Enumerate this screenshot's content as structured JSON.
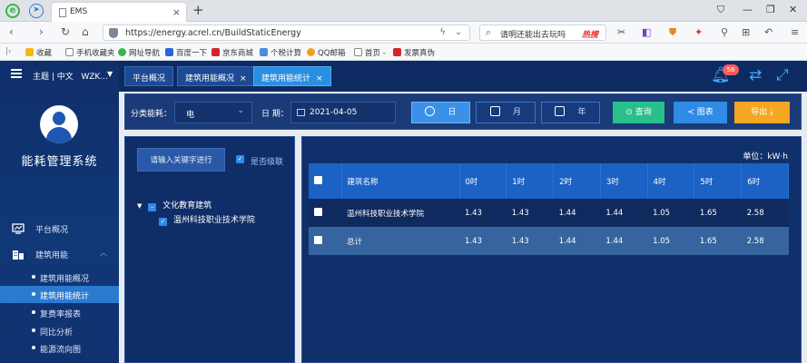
{
  "browser": {
    "tab_title": "EMS",
    "url": "https://energy.acrel.cn/BuildStaticEnergy",
    "search_text": "请明还能出去玩吗",
    "search_hot": "热搜",
    "bookmarks": [
      "收藏",
      "手机收藏夹",
      "网址导航",
      "百度一下",
      "京东商城",
      "个税计算",
      "QQ邮箱",
      "首页 -",
      "发票真伪"
    ]
  },
  "sidebar": {
    "theme_label": "主题 | 中文",
    "user_label": "WZK...",
    "system_name": "能耗管理系统",
    "nav": [
      {
        "label": "平台概况"
      },
      {
        "label": "建筑用能"
      }
    ],
    "subitems": [
      {
        "label": "建筑用能概况"
      },
      {
        "label": "建筑用能统计"
      },
      {
        "label": "复费率报表"
      },
      {
        "label": "同比分析"
      },
      {
        "label": "能源流向图"
      }
    ]
  },
  "tabs": [
    {
      "label": "平台概况"
    },
    {
      "label": "建筑用能概况"
    },
    {
      "label": "建筑用能统计"
    }
  ],
  "notification_count": "56",
  "filters": {
    "category_label": "分类能耗：",
    "category_value": "电",
    "date_label": "日 期：",
    "date_value": "2021-04-05",
    "day_btn": "日",
    "month_btn": "月",
    "year_btn": "年",
    "query_btn": "查询",
    "chart_btn": "图表",
    "export_btn": "导出"
  },
  "tree": {
    "keyword_btn": "请输入关键字进行",
    "level_label": "是否级联",
    "root": "文化教育建筑",
    "child": "温州科技职业技术学院"
  },
  "table": {
    "unit": "单位：kW·h",
    "headers": [
      "建筑名称",
      "0时",
      "1时",
      "2时",
      "3时",
      "4时",
      "5时",
      "6时"
    ],
    "rows": [
      [
        "温州科技职业技术学院",
        "1.43",
        "1.43",
        "1.44",
        "1.44",
        "1.05",
        "1.65",
        "2.58"
      ],
      [
        "总计",
        "1.43",
        "1.43",
        "1.44",
        "1.44",
        "1.05",
        "1.65",
        "2.58"
      ]
    ]
  }
}
